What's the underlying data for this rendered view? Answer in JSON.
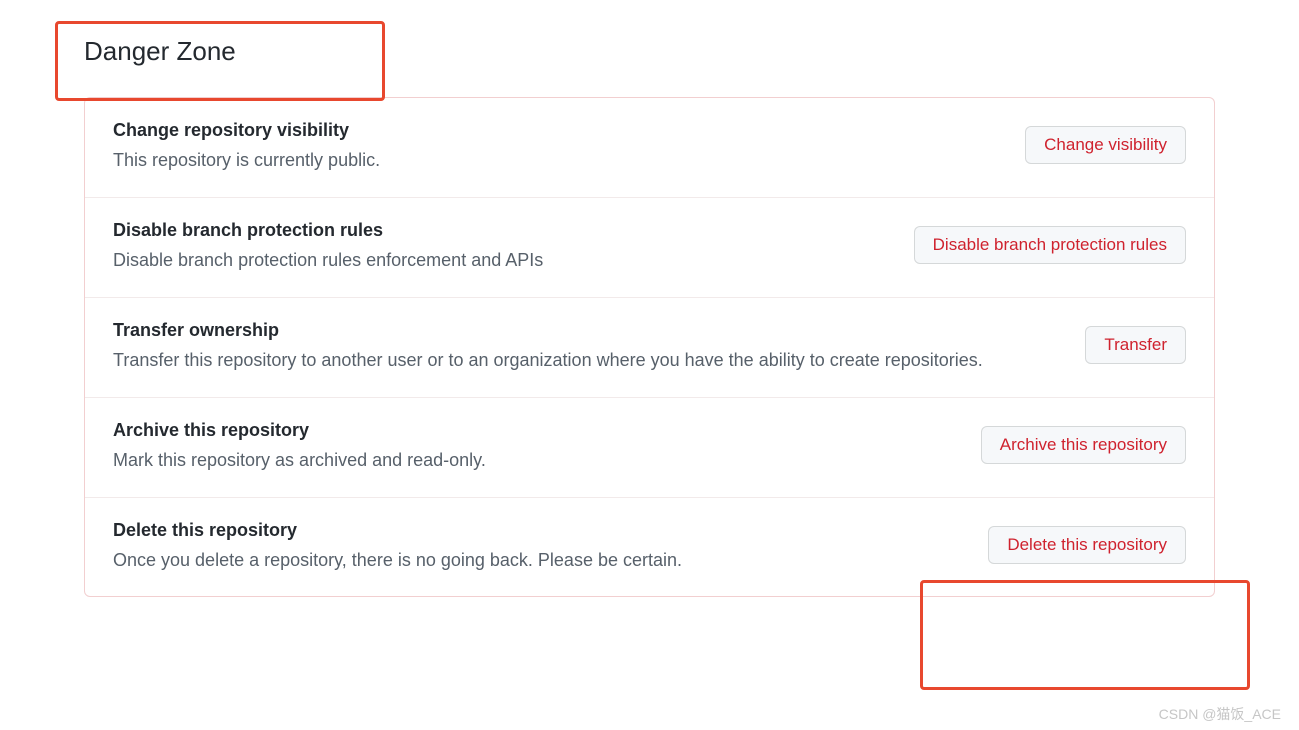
{
  "section_title": "Danger Zone",
  "rows": [
    {
      "title": "Change repository visibility",
      "desc": "This repository is currently public.",
      "button": "Change visibility"
    },
    {
      "title": "Disable branch protection rules",
      "desc": "Disable branch protection rules enforcement and APIs",
      "button": "Disable branch protection rules"
    },
    {
      "title": "Transfer ownership",
      "desc": "Transfer this repository to another user or to an organization where you have the ability to create repositories.",
      "button": "Transfer"
    },
    {
      "title": "Archive this repository",
      "desc": "Mark this repository as archived and read-only.",
      "button": "Archive this repository"
    },
    {
      "title": "Delete this repository",
      "desc": "Once you delete a repository, there is no going back. Please be certain.",
      "button": "Delete this repository"
    }
  ],
  "watermark": "CSDN @猫饭_ACE"
}
